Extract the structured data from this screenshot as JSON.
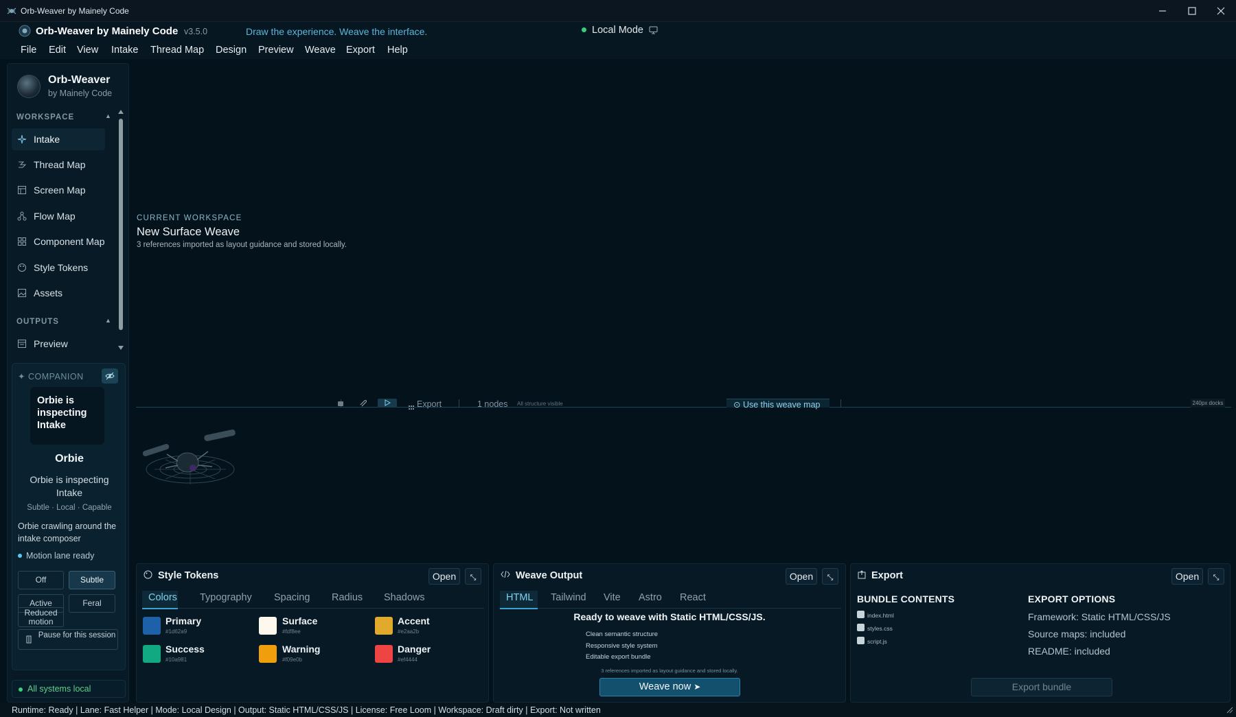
{
  "window": {
    "title": "Orb-Weaver by Mainely Code"
  },
  "header": {
    "app_name": "Orb-Weaver by Mainely Code",
    "version": "v3.5.0",
    "tagline": "Draw the experience. Weave the interface.",
    "mode": "Local Mode"
  },
  "menu": [
    "File",
    "Edit",
    "View",
    "Intake",
    "Thread Map",
    "Design",
    "Preview",
    "Weave",
    "Export",
    "Help"
  ],
  "sidebar": {
    "brand_name": "Orb-Weaver",
    "brand_sub": "by Mainely Code",
    "workspace_label": "WORKSPACE",
    "workspace_items": [
      {
        "label": "Intake",
        "icon": "sparkle-icon"
      },
      {
        "label": "Thread Map",
        "icon": "thread-icon"
      },
      {
        "label": "Screen Map",
        "icon": "screen-icon"
      },
      {
        "label": "Flow Map",
        "icon": "flow-icon"
      },
      {
        "label": "Component Map",
        "icon": "grid-icon"
      },
      {
        "label": "Style Tokens",
        "icon": "palette-icon"
      },
      {
        "label": "Assets",
        "icon": "image-icon"
      }
    ],
    "outputs_label": "OUTPUTS",
    "output_items": [
      {
        "label": "Preview",
        "icon": "preview-icon"
      }
    ],
    "active": "Intake"
  },
  "companion": {
    "header": "COMPANION",
    "bubble": "Orbie is inspecting Intake",
    "name": "Orbie",
    "status": "Orbie is inspecting Intake",
    "traits": "Subtle · Local · Capable",
    "description": "Orbie crawling around the intake composer",
    "motion": "Motion lane ready",
    "modes": [
      "Off",
      "Subtle",
      "Active",
      "Feral",
      "Reduced motion"
    ],
    "selected_mode": "Subtle",
    "pause": "Pause for this session",
    "system": "All systems local"
  },
  "workspace": {
    "label": "CURRENT WORKSPACE",
    "title": "New Surface Weave",
    "subtitle": "3 references imported as layout guidance and stored locally."
  },
  "toolbar": {
    "export": "Export",
    "nodes": "1 nodes",
    "structure": "All structure visible",
    "use_map": "Use this weave map",
    "docs": "240px docks"
  },
  "style_tokens": {
    "title": "Style Tokens",
    "open": "Open",
    "tabs": [
      "Colors",
      "Typography",
      "Spacing",
      "Radius",
      "Shadows"
    ],
    "active_tab": "Colors",
    "colors": [
      {
        "name": "Primary",
        "hex": "#1d62a9"
      },
      {
        "name": "Surface",
        "hex": "#fdf8ee"
      },
      {
        "name": "Accent",
        "hex": "#e2aa2b"
      },
      {
        "name": "Success",
        "hex": "#10a981"
      },
      {
        "name": "Warning",
        "hex": "#f09e0b"
      },
      {
        "name": "Danger",
        "hex": "#ef4444"
      }
    ]
  },
  "weave_output": {
    "title": "Weave Output",
    "open": "Open",
    "tabs": [
      "HTML",
      "Tailwind",
      "Vite",
      "Astro",
      "React"
    ],
    "active_tab": "HTML",
    "ready": "Ready to weave with Static HTML/CSS/JS.",
    "features": [
      "Clean semantic structure",
      "Responsive style system",
      "Editable export bundle"
    ],
    "note": "3 references imported as layout guidance and stored locally.",
    "button": "Weave now"
  },
  "export": {
    "title": "Export",
    "open": "Open",
    "bundle_label": "BUNDLE CONTENTS",
    "files": [
      "index.html",
      "styles.css",
      "script.js"
    ],
    "options_label": "EXPORT OPTIONS",
    "options": [
      "Framework: Static HTML/CSS/JS",
      "Source maps: included",
      "README: included"
    ],
    "button": "Export bundle"
  },
  "status": "Runtime: Ready | Lane: Fast Helper | Mode: Local Design | Output: Static HTML/CSS/JS | License: Free Loom | Workspace: Draft dirty | Export: Not written",
  "colors": {
    "background": "#04121c",
    "accent": "#3aa3d0",
    "ok": "#35d07a"
  }
}
